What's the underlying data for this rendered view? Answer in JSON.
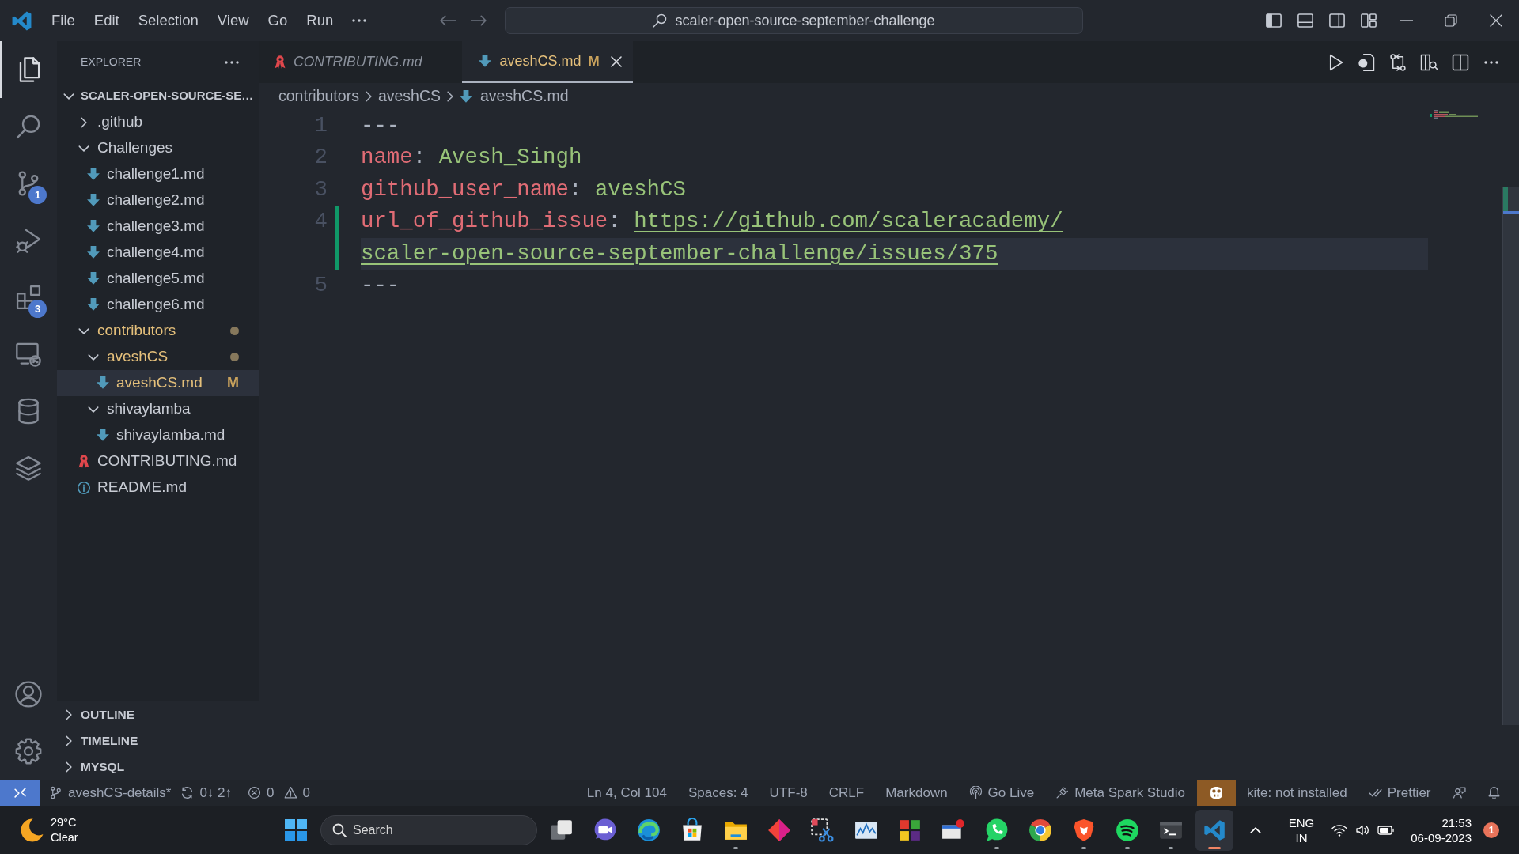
{
  "title_bar": {
    "menu": [
      "File",
      "Edit",
      "Selection",
      "View",
      "Go",
      "Run"
    ],
    "command_center": "scaler-open-source-september-challenge"
  },
  "activity_bar": {
    "items": [
      {
        "kind": "files",
        "selected": true
      },
      {
        "kind": "search",
        "selected": false
      },
      {
        "kind": "source-control",
        "selected": false,
        "badge": "1"
      },
      {
        "kind": "run",
        "selected": false
      },
      {
        "kind": "extensions",
        "selected": false,
        "badge": "3"
      },
      {
        "kind": "remote",
        "selected": false
      },
      {
        "kind": "database",
        "selected": false
      },
      {
        "kind": "layers",
        "selected": false
      }
    ],
    "bottom": [
      {
        "kind": "account"
      },
      {
        "kind": "settings"
      }
    ]
  },
  "sidebar": {
    "title": "EXPLORER",
    "tree": [
      {
        "label": "SCALER-OPEN-SOURCE-SE…",
        "kind": "root",
        "expanded": true,
        "selected": false,
        "modified": false,
        "children": [
          {
            "label": ".github",
            "kind": "folder",
            "expanded": false,
            "selected": false,
            "modified": false
          },
          {
            "label": "Challenges",
            "kind": "folder",
            "expanded": true,
            "selected": false,
            "modified": false,
            "children": [
              {
                "label": "challenge1.md",
                "kind": "markdown",
                "selected": false,
                "modified": false
              },
              {
                "label": "challenge2.md",
                "kind": "markdown",
                "selected": false,
                "modified": false
              },
              {
                "label": "challenge3.md",
                "kind": "markdown",
                "selected": false,
                "modified": false
              },
              {
                "label": "challenge4.md",
                "kind": "markdown",
                "selected": false,
                "modified": false
              },
              {
                "label": "challenge5.md",
                "kind": "markdown",
                "selected": false,
                "modified": false
              },
              {
                "label": "challenge6.md",
                "kind": "markdown",
                "selected": false,
                "modified": false
              }
            ]
          },
          {
            "label": "contributors",
            "kind": "folder",
            "expanded": true,
            "selected": false,
            "modified": true,
            "children": [
              {
                "label": "aveshCS",
                "kind": "folder",
                "expanded": true,
                "selected": false,
                "modified": true,
                "children": [
                  {
                    "label": "aveshCS.md",
                    "kind": "markdown",
                    "selected": true,
                    "modified": true,
                    "git_status": "M"
                  }
                ]
              },
              {
                "label": "shivaylamba",
                "kind": "folder",
                "expanded": true,
                "selected": false,
                "modified": false,
                "children": [
                  {
                    "label": "shivaylamba.md",
                    "kind": "markdown",
                    "selected": false,
                    "modified": false
                  }
                ]
              }
            ]
          },
          {
            "label": "CONTRIBUTING.md",
            "kind": "guidelines",
            "selected": false,
            "modified": false
          },
          {
            "label": "README.md",
            "kind": "info",
            "selected": false,
            "modified": false
          }
        ]
      }
    ],
    "sections": [
      {
        "label": "OUTLINE",
        "expanded": false
      },
      {
        "label": "TIMELINE",
        "expanded": false
      },
      {
        "label": "MYSQL",
        "expanded": false
      }
    ]
  },
  "tabs": [
    {
      "label": "CONTRIBUTING.md",
      "kind": "guidelines",
      "selected": false,
      "preview": true,
      "modified": false
    },
    {
      "label": "aveshCS.md",
      "kind": "markdown",
      "selected": true,
      "preview": false,
      "modified": true,
      "git_status": "M"
    }
  ],
  "breadcrumb": [
    {
      "label": "contributors"
    },
    {
      "label": "aveshCS"
    },
    {
      "label": "aveshCS.md",
      "kind": "markdown"
    }
  ],
  "editor": {
    "lines": [
      {
        "number": "1",
        "changed": false,
        "current": false,
        "tokens": [
          {
            "kind": "punct",
            "text": "---"
          }
        ]
      },
      {
        "number": "2",
        "changed": false,
        "current": false,
        "tokens": [
          {
            "kind": "key",
            "text": "name"
          },
          {
            "kind": "punct",
            "text": ": "
          },
          {
            "kind": "string",
            "text": "Avesh_Singh"
          }
        ]
      },
      {
        "number": "3",
        "changed": false,
        "current": false,
        "tokens": [
          {
            "kind": "key",
            "text": "github_user_name"
          },
          {
            "kind": "punct",
            "text": ": "
          },
          {
            "kind": "string",
            "text": "aveshCS"
          }
        ]
      },
      {
        "number": "4",
        "changed": true,
        "current": true,
        "tokens": [
          {
            "kind": "key",
            "text": "url_of_github_issue"
          },
          {
            "kind": "punct",
            "text": ": "
          },
          {
            "kind": "url",
            "text": "https://github.com/scaleracademy/scaler-open-source-september-challenge/issues/375"
          }
        ]
      },
      {
        "number": "5",
        "changed": false,
        "current": false,
        "tokens": [
          {
            "kind": "punct",
            "text": "---"
          }
        ]
      }
    ]
  },
  "status_bar": {
    "left": [
      {
        "kind": "remote"
      },
      {
        "kind": "branch",
        "text": "aveshCS-details*"
      },
      {
        "kind": "sync",
        "text": "0↓ 2↑"
      },
      {
        "kind": "errors",
        "text": "0"
      },
      {
        "kind": "warnings",
        "text": "0"
      }
    ],
    "right": [
      {
        "kind": "text",
        "text": "Ln 4, Col 104"
      },
      {
        "kind": "text",
        "text": "Spaces: 4"
      },
      {
        "kind": "text",
        "text": "UTF-8"
      },
      {
        "kind": "text",
        "text": "CRLF"
      },
      {
        "kind": "text",
        "text": "Markdown"
      },
      {
        "kind": "broadcast",
        "text": "Go Live"
      },
      {
        "kind": "plugin",
        "text": "Meta Spark Studio"
      },
      {
        "kind": "assistant"
      },
      {
        "kind": "text",
        "text": "kite: not installed"
      },
      {
        "kind": "formatter",
        "text": "Prettier"
      },
      {
        "kind": "feedback"
      },
      {
        "kind": "notifications"
      }
    ]
  },
  "taskbar": {
    "weather": {
      "temperature": "29°C",
      "condition": "Clear"
    },
    "search": {
      "placeholder": "Search"
    },
    "apps": [
      {
        "kind": "task-view",
        "running": false,
        "active": false
      },
      {
        "kind": "video-chat",
        "running": false,
        "active": false
      },
      {
        "kind": "swirl",
        "running": false,
        "active": false
      },
      {
        "kind": "bag",
        "running": false,
        "active": false
      },
      {
        "kind": "folder",
        "running": true,
        "active": false
      },
      {
        "kind": "diamond",
        "running": false,
        "active": false
      },
      {
        "kind": "scissors",
        "running": false,
        "active": false
      },
      {
        "kind": "chart",
        "running": false,
        "active": false
      },
      {
        "kind": "tiles",
        "running": false,
        "active": false
      },
      {
        "kind": "window-pin",
        "running": false,
        "active": false
      },
      {
        "kind": "chat",
        "running": true,
        "active": false
      },
      {
        "kind": "segmented-circle",
        "running": false,
        "active": false
      },
      {
        "kind": "shield",
        "running": true,
        "active": false
      },
      {
        "kind": "sound-arcs",
        "running": true,
        "active": false
      },
      {
        "kind": "terminal",
        "running": true,
        "active": false
      },
      {
        "kind": "code",
        "running": true,
        "active": true
      }
    ],
    "tray": {
      "language": "ENG",
      "region": "IN",
      "time": "21:53",
      "date": "06-09-2023",
      "notification_count": "1"
    }
  }
}
